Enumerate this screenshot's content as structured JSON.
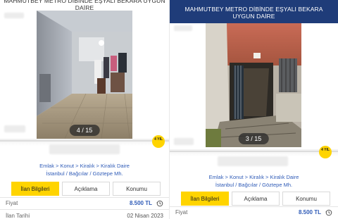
{
  "left": {
    "title": "MAHMUTBEY METRO DİBİNDE EŞYALI BEKARA UYGUN DAİRE",
    "counter": "4 / 15",
    "badge": "4 YIL",
    "breadcrumb_line1": "Emlak > Konut > Kiralık > Kiralık Daire",
    "breadcrumb_line2": "İstanbul / Bağcılar / Göztepe Mh.",
    "tabs": [
      "İlan Bilgileri",
      "Açıklama",
      "Konumu"
    ],
    "rows": [
      {
        "label": "Fiyat",
        "value": "8.500 TL"
      },
      {
        "label": "İlan Tarihi",
        "value": "02 Nisan 2023"
      }
    ]
  },
  "right": {
    "title": "MAHMUTBEY METRO DİBİNDE EŞYALI BEKARA UYGUN DAİRE",
    "counter": "3 / 15",
    "badge": "4 YIL",
    "breadcrumb_line1": "Emlak > Konut > Kiralık > Kiralık Daire",
    "breadcrumb_line2": "İstanbul / Bağcılar / Göztepe Mh.",
    "tabs": [
      "İlan Bilgileri",
      "Açıklama",
      "Konumu"
    ],
    "rows": [
      {
        "label": "Fiyat",
        "value": "8.500 TL"
      }
    ]
  },
  "colors": {
    "accent_yellow": "#ffd400",
    "header_navy": "#1f3c79",
    "link_blue": "#2f5bb7"
  },
  "icons": {
    "history": "history-icon"
  }
}
